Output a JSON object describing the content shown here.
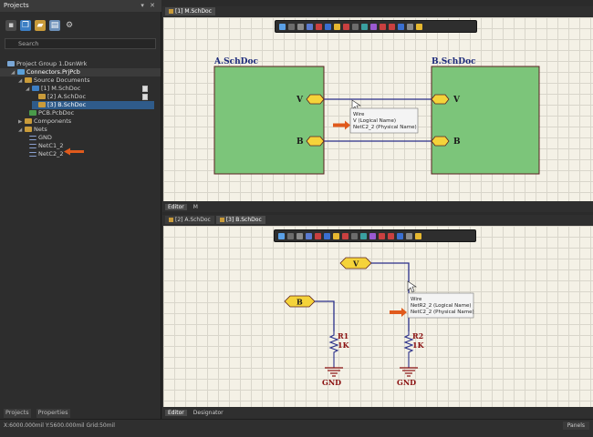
{
  "projects_panel": {
    "title": "Projects",
    "controls": "▾ ✕",
    "search_placeholder": "Search",
    "tree": [
      {
        "label": "Project Group 1.DsnWrk",
        "indent": 0,
        "icon": "workspace"
      },
      {
        "label": "Connectors.PrjPcb",
        "indent": 1,
        "icon": "project"
      },
      {
        "label": "Source Documents",
        "indent": 2,
        "icon": "folder"
      },
      {
        "label": "[1] M.SchDoc",
        "indent": 3,
        "icon": "doc"
      },
      {
        "label": "[2] A.SchDoc",
        "indent": 4,
        "icon": "doc"
      },
      {
        "label": "[3] B.SchDoc",
        "indent": 4,
        "icon": "doc",
        "selected": true
      },
      {
        "label": "PCB.PcbDoc",
        "indent": 3,
        "icon": "pcb"
      },
      {
        "label": "Components",
        "indent": 2,
        "icon": "folder"
      },
      {
        "label": "Nets",
        "indent": 2,
        "icon": "folder"
      },
      {
        "label": "GND",
        "indent": 3,
        "icon": "net"
      },
      {
        "label": "NetC1_2",
        "indent": 3,
        "icon": "net"
      },
      {
        "label": "NetC2_2",
        "indent": 3,
        "icon": "net"
      }
    ],
    "tabs": [
      "Projects",
      "Properties"
    ]
  },
  "top_editor": {
    "tab": "[1] M.SchDoc",
    "sheet_a": "A.SchDoc",
    "sheet_b": "B.SchDoc",
    "pin_v": "V",
    "pin_b": "B",
    "tooltip": {
      "type": "Wire",
      "line1": "V (Logical Name)",
      "line2": "NetC2_2 (Physical Name)"
    },
    "bottom_tabs": [
      "Editor",
      "M"
    ]
  },
  "bottom_editor": {
    "tabs": [
      "[2] A.SchDoc",
      "[3] B.SchDoc"
    ],
    "port_v": "V",
    "port_b": "B",
    "r1": {
      "name": "R1",
      "value": "1K"
    },
    "r2": {
      "name": "R2",
      "value": "1K"
    },
    "gnd_label": "GND",
    "tooltip": {
      "type": "Wire",
      "line1": "NetR2_2 (Logical Name)",
      "line2": "NetC2_2 (Physical Name)"
    },
    "bottom_tabs": [
      "Editor",
      "Designator"
    ]
  },
  "status_bar": {
    "text": "X:6000.000mil Y:5600.000mil   Grid:50mil",
    "panels": "Panels"
  },
  "colors": {
    "sheet_fill": "#7cc57a",
    "wire": "#2a2f8a",
    "port_fill": "#f5d33a",
    "arrow": "#e05a1c"
  }
}
